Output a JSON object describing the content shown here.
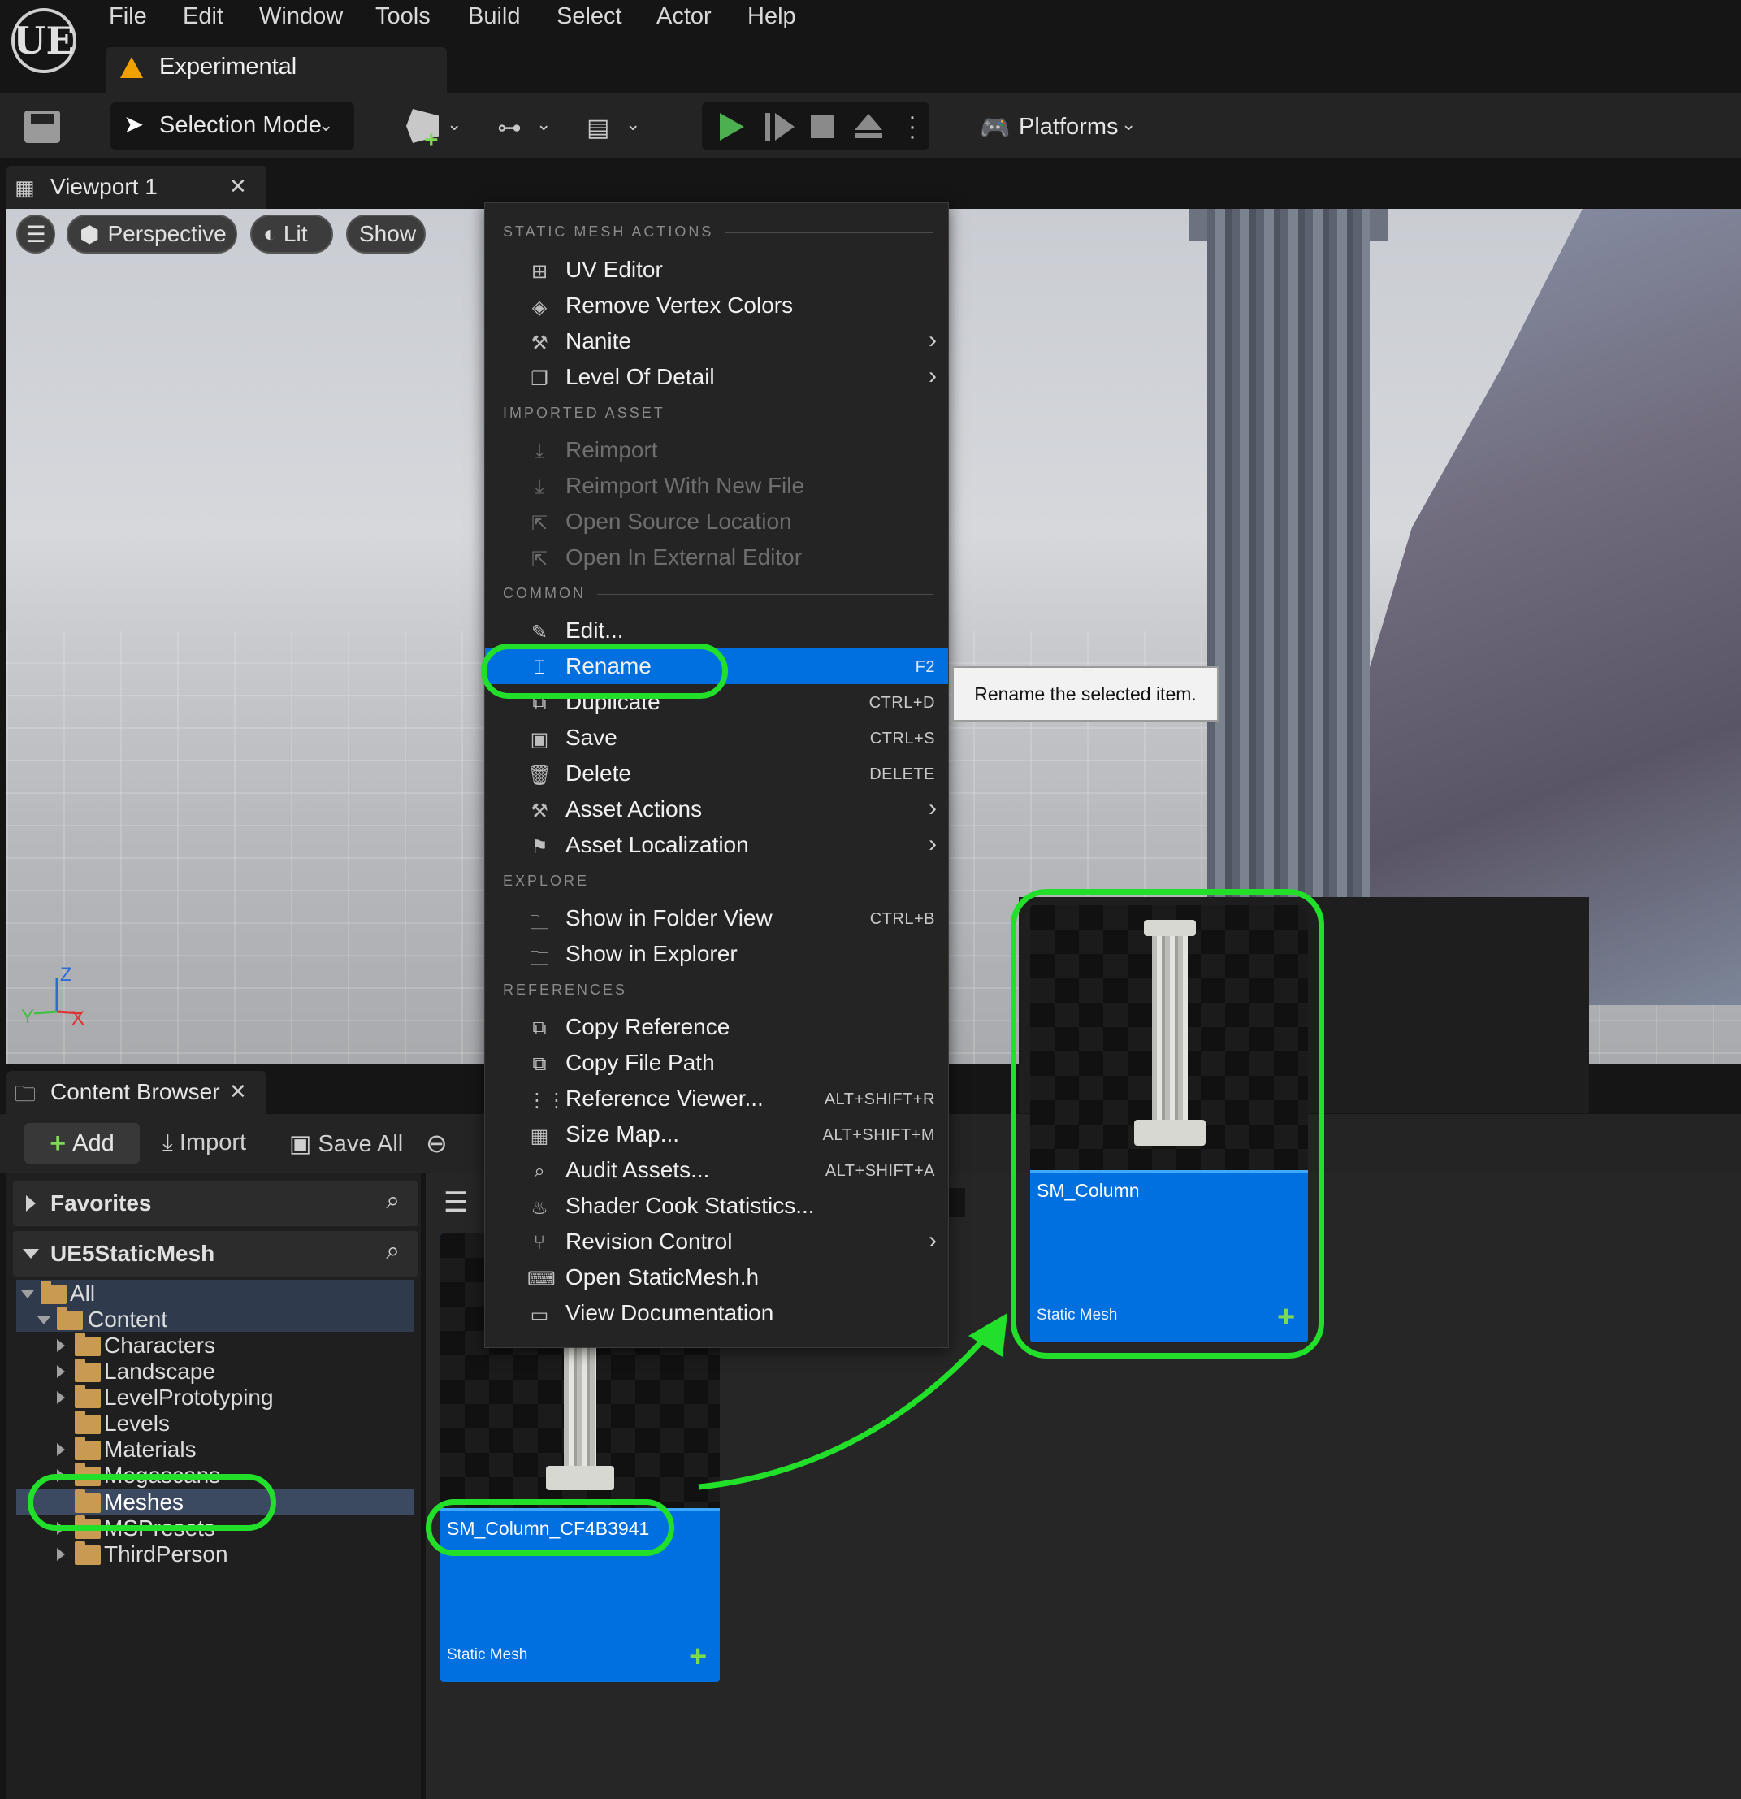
{
  "menubar": {
    "logo": "UE",
    "items": [
      "File",
      "Edit",
      "Window",
      "Tools",
      "Build",
      "Select",
      "Actor",
      "Help"
    ],
    "project_tab": "Experimental"
  },
  "toolbar": {
    "selection_mode": "Selection Mode",
    "platforms": "Platforms"
  },
  "viewport": {
    "tab_label": "Viewport 1",
    "perspective": "Perspective",
    "lit": "Lit",
    "show": "Show",
    "axis": {
      "z": "Z",
      "y": "Y",
      "x": "X"
    }
  },
  "context_menu": {
    "sections": {
      "static_mesh_actions": "STATIC MESH ACTIONS",
      "imported_asset": "IMPORTED ASSET",
      "common": "COMMON",
      "explore": "EXPLORE",
      "references": "REFERENCES"
    },
    "items": {
      "uv_editor": "UV Editor",
      "remove_vertex_colors": "Remove Vertex Colors",
      "nanite": "Nanite",
      "level_of_detail": "Level Of Detail",
      "reimport": "Reimport",
      "reimport_new_file": "Reimport With New File",
      "open_source_location": "Open Source Location",
      "open_external_editor": "Open In External Editor",
      "edit": "Edit...",
      "rename": "Rename",
      "duplicate": "Duplicate",
      "save": "Save",
      "delete": "Delete",
      "asset_actions": "Asset Actions",
      "asset_localization": "Asset Localization",
      "show_in_folder_view": "Show in Folder View",
      "show_in_explorer": "Show in Explorer",
      "copy_reference": "Copy Reference",
      "copy_file_path": "Copy File Path",
      "reference_viewer": "Reference Viewer...",
      "size_map": "Size Map...",
      "audit_assets": "Audit Assets...",
      "shader_cook_statistics": "Shader Cook Statistics...",
      "revision_control": "Revision Control",
      "open_staticmesh_h": "Open StaticMesh.h",
      "view_documentation": "View Documentation"
    },
    "shortcuts": {
      "rename": "F2",
      "duplicate": "CTRL+D",
      "save": "CTRL+S",
      "delete": "DELETE",
      "show_in_folder_view": "CTRL+B",
      "reference_viewer": "ALT+SHIFT+R",
      "size_map": "ALT+SHIFT+M",
      "audit_assets": "ALT+SHIFT+A"
    }
  },
  "tooltip": "Rename the selected item.",
  "content_browser": {
    "tab_label": "Content Browser",
    "add": "Add",
    "import": "Import",
    "save_all": "Save All",
    "favorites": "Favorites",
    "project": "UE5StaticMesh",
    "tree": {
      "all": "All",
      "content": "Content",
      "folders": [
        "Characters",
        "Landscape",
        "LevelPrototyping",
        "Levels",
        "Materials",
        "Megascans",
        "Meshes",
        "MSPresets",
        "ThirdPerson"
      ]
    },
    "asset_original": {
      "name": "SM_Column_CF4B3941",
      "type": "Static Mesh"
    },
    "asset_renamed": {
      "name": "SM_Column",
      "type": "Static Mesh"
    }
  },
  "colors": {
    "highlight_blue": "#0070e0",
    "annotation_green": "#22e02a",
    "play_green": "#4caf50",
    "folder": "#c99b52"
  }
}
